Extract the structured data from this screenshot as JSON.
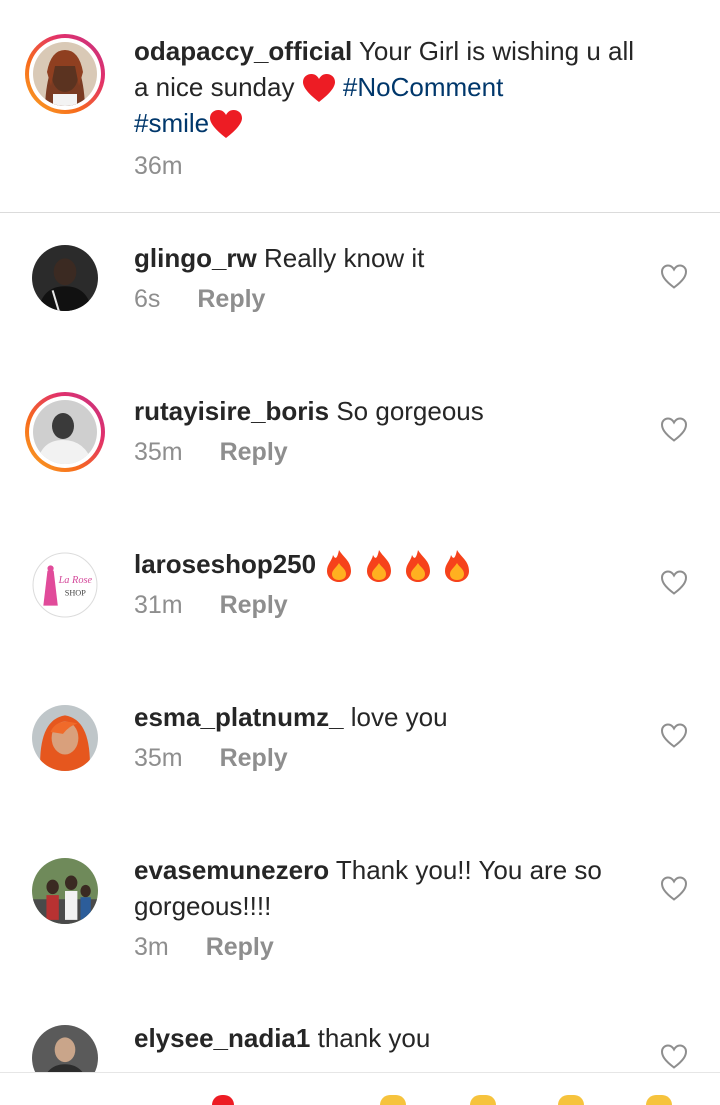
{
  "caption": {
    "username": "odapaccy_official",
    "text": "Your Girl is wishing u all a nice sunday",
    "heart_emoji": "red-heart",
    "hashtag_1": "#NoComment",
    "hashtag_2": "#smile",
    "time": "36m"
  },
  "reply_label": "Reply",
  "comments": [
    {
      "username": "glingo_rw",
      "text": "Really know it",
      "time": "6s"
    },
    {
      "username": "rutayisire_boris",
      "text": "So gorgeous",
      "time": "35m"
    },
    {
      "username": "laroseshop250",
      "text": "",
      "emoji": "fire x4",
      "time": "31m"
    },
    {
      "username": "esma_platnumz_",
      "text": "love you",
      "time": "35m"
    },
    {
      "username": "evasemunezero",
      "text": "Thank you!! You are so gorgeous!!!!",
      "time": "3m"
    },
    {
      "username": "elysee_nadia1",
      "text": "thank you",
      "time": ""
    }
  ],
  "shop_logo": {
    "line1": "La Rose",
    "line2": "SHOP"
  },
  "colors": {
    "link": "#00376b",
    "muted": "#8e8e8e",
    "text": "#262626",
    "heart": "#ed1c24"
  }
}
